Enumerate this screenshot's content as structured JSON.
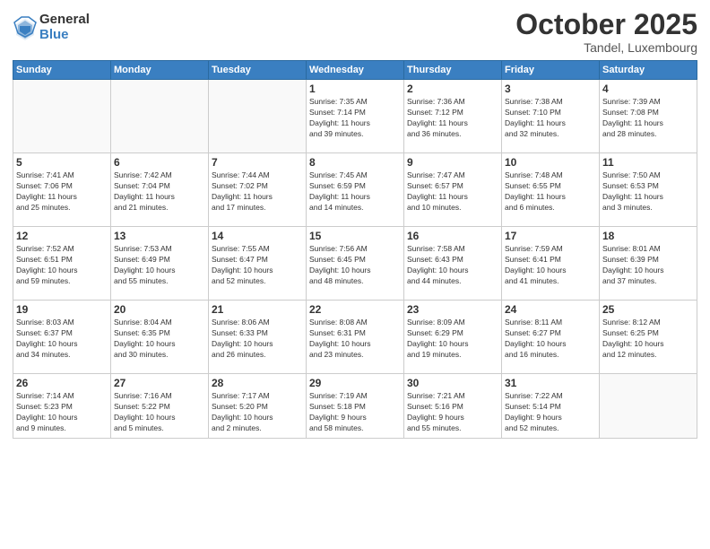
{
  "header": {
    "logo_general": "General",
    "logo_blue": "Blue",
    "month": "October 2025",
    "location": "Tandel, Luxembourg"
  },
  "days_of_week": [
    "Sunday",
    "Monday",
    "Tuesday",
    "Wednesday",
    "Thursday",
    "Friday",
    "Saturday"
  ],
  "weeks": [
    [
      {
        "day": "",
        "info": ""
      },
      {
        "day": "",
        "info": ""
      },
      {
        "day": "",
        "info": ""
      },
      {
        "day": "1",
        "info": "Sunrise: 7:35 AM\nSunset: 7:14 PM\nDaylight: 11 hours\nand 39 minutes."
      },
      {
        "day": "2",
        "info": "Sunrise: 7:36 AM\nSunset: 7:12 PM\nDaylight: 11 hours\nand 36 minutes."
      },
      {
        "day": "3",
        "info": "Sunrise: 7:38 AM\nSunset: 7:10 PM\nDaylight: 11 hours\nand 32 minutes."
      },
      {
        "day": "4",
        "info": "Sunrise: 7:39 AM\nSunset: 7:08 PM\nDaylight: 11 hours\nand 28 minutes."
      }
    ],
    [
      {
        "day": "5",
        "info": "Sunrise: 7:41 AM\nSunset: 7:06 PM\nDaylight: 11 hours\nand 25 minutes."
      },
      {
        "day": "6",
        "info": "Sunrise: 7:42 AM\nSunset: 7:04 PM\nDaylight: 11 hours\nand 21 minutes."
      },
      {
        "day": "7",
        "info": "Sunrise: 7:44 AM\nSunset: 7:02 PM\nDaylight: 11 hours\nand 17 minutes."
      },
      {
        "day": "8",
        "info": "Sunrise: 7:45 AM\nSunset: 6:59 PM\nDaylight: 11 hours\nand 14 minutes."
      },
      {
        "day": "9",
        "info": "Sunrise: 7:47 AM\nSunset: 6:57 PM\nDaylight: 11 hours\nand 10 minutes."
      },
      {
        "day": "10",
        "info": "Sunrise: 7:48 AM\nSunset: 6:55 PM\nDaylight: 11 hours\nand 6 minutes."
      },
      {
        "day": "11",
        "info": "Sunrise: 7:50 AM\nSunset: 6:53 PM\nDaylight: 11 hours\nand 3 minutes."
      }
    ],
    [
      {
        "day": "12",
        "info": "Sunrise: 7:52 AM\nSunset: 6:51 PM\nDaylight: 10 hours\nand 59 minutes."
      },
      {
        "day": "13",
        "info": "Sunrise: 7:53 AM\nSunset: 6:49 PM\nDaylight: 10 hours\nand 55 minutes."
      },
      {
        "day": "14",
        "info": "Sunrise: 7:55 AM\nSunset: 6:47 PM\nDaylight: 10 hours\nand 52 minutes."
      },
      {
        "day": "15",
        "info": "Sunrise: 7:56 AM\nSunset: 6:45 PM\nDaylight: 10 hours\nand 48 minutes."
      },
      {
        "day": "16",
        "info": "Sunrise: 7:58 AM\nSunset: 6:43 PM\nDaylight: 10 hours\nand 44 minutes."
      },
      {
        "day": "17",
        "info": "Sunrise: 7:59 AM\nSunset: 6:41 PM\nDaylight: 10 hours\nand 41 minutes."
      },
      {
        "day": "18",
        "info": "Sunrise: 8:01 AM\nSunset: 6:39 PM\nDaylight: 10 hours\nand 37 minutes."
      }
    ],
    [
      {
        "day": "19",
        "info": "Sunrise: 8:03 AM\nSunset: 6:37 PM\nDaylight: 10 hours\nand 34 minutes."
      },
      {
        "day": "20",
        "info": "Sunrise: 8:04 AM\nSunset: 6:35 PM\nDaylight: 10 hours\nand 30 minutes."
      },
      {
        "day": "21",
        "info": "Sunrise: 8:06 AM\nSunset: 6:33 PM\nDaylight: 10 hours\nand 26 minutes."
      },
      {
        "day": "22",
        "info": "Sunrise: 8:08 AM\nSunset: 6:31 PM\nDaylight: 10 hours\nand 23 minutes."
      },
      {
        "day": "23",
        "info": "Sunrise: 8:09 AM\nSunset: 6:29 PM\nDaylight: 10 hours\nand 19 minutes."
      },
      {
        "day": "24",
        "info": "Sunrise: 8:11 AM\nSunset: 6:27 PM\nDaylight: 10 hours\nand 16 minutes."
      },
      {
        "day": "25",
        "info": "Sunrise: 8:12 AM\nSunset: 6:25 PM\nDaylight: 10 hours\nand 12 minutes."
      }
    ],
    [
      {
        "day": "26",
        "info": "Sunrise: 7:14 AM\nSunset: 5:23 PM\nDaylight: 10 hours\nand 9 minutes."
      },
      {
        "day": "27",
        "info": "Sunrise: 7:16 AM\nSunset: 5:22 PM\nDaylight: 10 hours\nand 5 minutes."
      },
      {
        "day": "28",
        "info": "Sunrise: 7:17 AM\nSunset: 5:20 PM\nDaylight: 10 hours\nand 2 minutes."
      },
      {
        "day": "29",
        "info": "Sunrise: 7:19 AM\nSunset: 5:18 PM\nDaylight: 9 hours\nand 58 minutes."
      },
      {
        "day": "30",
        "info": "Sunrise: 7:21 AM\nSunset: 5:16 PM\nDaylight: 9 hours\nand 55 minutes."
      },
      {
        "day": "31",
        "info": "Sunrise: 7:22 AM\nSunset: 5:14 PM\nDaylight: 9 hours\nand 52 minutes."
      },
      {
        "day": "",
        "info": ""
      }
    ]
  ]
}
